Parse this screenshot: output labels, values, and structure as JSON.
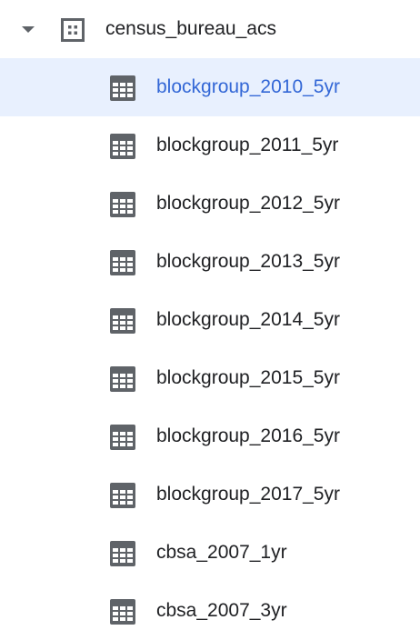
{
  "colors": {
    "selected_row_bg": "#e8f0fe",
    "selected_text": "#3367d6",
    "icon_gray": "#5f6368",
    "text": "#202124"
  },
  "tree": {
    "dataset": {
      "label": "census_bureau_acs",
      "icon": "dataset-icon",
      "expanded": true
    },
    "tables": [
      {
        "label": "blockgroup_2010_5yr",
        "icon": "table-icon",
        "selected": true
      },
      {
        "label": "blockgroup_2011_5yr",
        "icon": "table-icon",
        "selected": false
      },
      {
        "label": "blockgroup_2012_5yr",
        "icon": "table-icon",
        "selected": false
      },
      {
        "label": "blockgroup_2013_5yr",
        "icon": "table-icon",
        "selected": false
      },
      {
        "label": "blockgroup_2014_5yr",
        "icon": "table-icon",
        "selected": false
      },
      {
        "label": "blockgroup_2015_5yr",
        "icon": "table-icon",
        "selected": false
      },
      {
        "label": "blockgroup_2016_5yr",
        "icon": "table-icon",
        "selected": false
      },
      {
        "label": "blockgroup_2017_5yr",
        "icon": "table-icon",
        "selected": false
      },
      {
        "label": "cbsa_2007_1yr",
        "icon": "table-icon",
        "selected": false
      },
      {
        "label": "cbsa_2007_3yr",
        "icon": "table-icon",
        "selected": false
      }
    ]
  }
}
